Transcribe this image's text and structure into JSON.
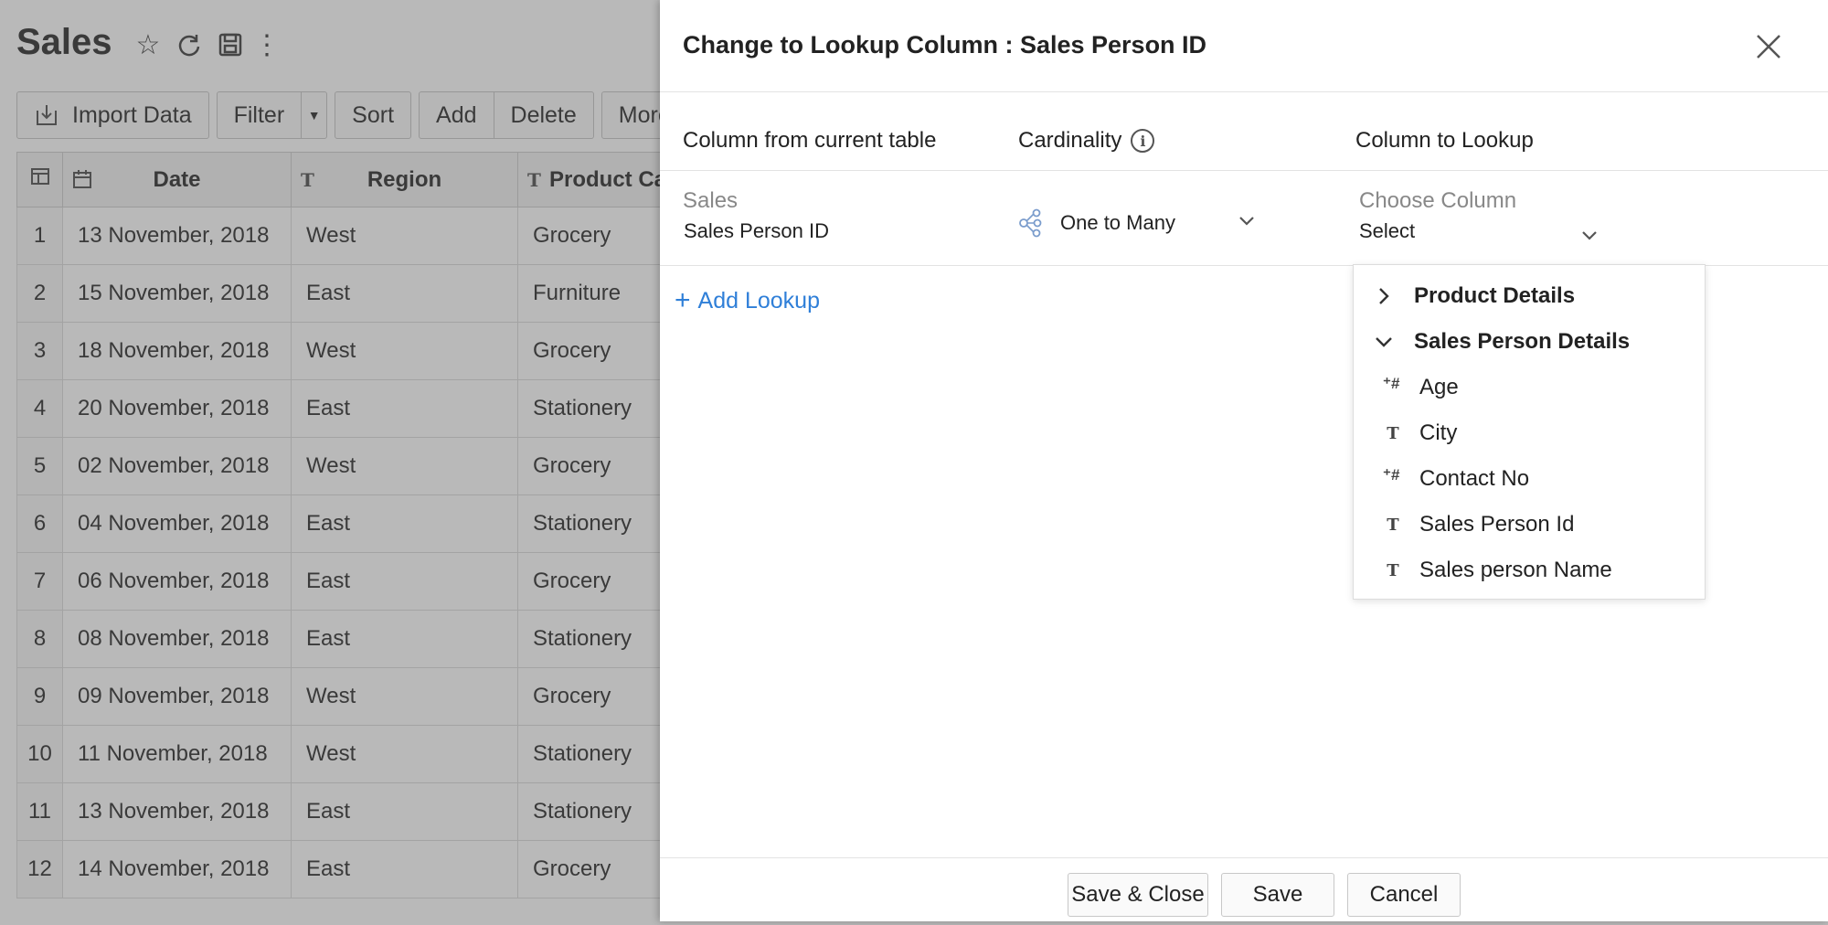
{
  "app": {
    "title": "Sales",
    "icons": [
      "star-icon",
      "refresh-icon",
      "save-icon",
      "more-vertical-icon"
    ]
  },
  "toolbar": {
    "import_label": "Import Data",
    "filter_label": "Filter",
    "sort_label": "Sort",
    "add_label": "Add",
    "delete_label": "Delete",
    "more_label": "More"
  },
  "table": {
    "headers": {
      "date": "Date",
      "region": "Region",
      "product": "Product Cat"
    },
    "rows": [
      {
        "n": "1",
        "date": "13 November, 2018",
        "region": "West",
        "product": "Grocery"
      },
      {
        "n": "2",
        "date": "15 November, 2018",
        "region": "East",
        "product": "Furniture"
      },
      {
        "n": "3",
        "date": "18 November, 2018",
        "region": "West",
        "product": "Grocery"
      },
      {
        "n": "4",
        "date": "20 November, 2018",
        "region": "East",
        "product": "Stationery"
      },
      {
        "n": "5",
        "date": "02 November, 2018",
        "region": "West",
        "product": "Grocery"
      },
      {
        "n": "6",
        "date": "04 November, 2018",
        "region": "East",
        "product": "Stationery"
      },
      {
        "n": "7",
        "date": "06 November, 2018",
        "region": "East",
        "product": "Grocery"
      },
      {
        "n": "8",
        "date": "08 November, 2018",
        "region": "East",
        "product": "Stationery"
      },
      {
        "n": "9",
        "date": "09 November, 2018",
        "region": "West",
        "product": "Grocery"
      },
      {
        "n": "10",
        "date": "11 November, 2018",
        "region": "West",
        "product": "Stationery"
      },
      {
        "n": "11",
        "date": "13 November, 2018",
        "region": "East",
        "product": "Stationery"
      },
      {
        "n": "12",
        "date": "14 November, 2018",
        "region": "East",
        "product": "Grocery"
      }
    ]
  },
  "dialog": {
    "title": "Change to Lookup Column : Sales Person ID",
    "col_current_header": "Column from current table",
    "cardinality_header": "Cardinality",
    "col_lookup_header": "Column to Lookup",
    "source_table": "Sales",
    "source_column": "Sales Person ID",
    "cardinality_value": "One to Many",
    "choose_label": "Choose Column",
    "choose_value": "Select",
    "add_lookup": "Add Lookup",
    "dropdown": {
      "groups": [
        {
          "label": "Product Details",
          "expanded": false
        },
        {
          "label": "Sales Person Details",
          "expanded": true
        }
      ],
      "items": [
        {
          "label": "Age",
          "type": "number"
        },
        {
          "label": "City",
          "type": "text"
        },
        {
          "label": "Contact No",
          "type": "number"
        },
        {
          "label": "Sales Person Id",
          "type": "text"
        },
        {
          "label": "Sales person Name",
          "type": "text"
        }
      ]
    },
    "buttons": {
      "save_close": "Save & Close",
      "save": "Save",
      "cancel": "Cancel"
    }
  },
  "colors": {
    "accent": "#2f7fd8",
    "overlay": "rgba(70,70,70,0.38)"
  }
}
